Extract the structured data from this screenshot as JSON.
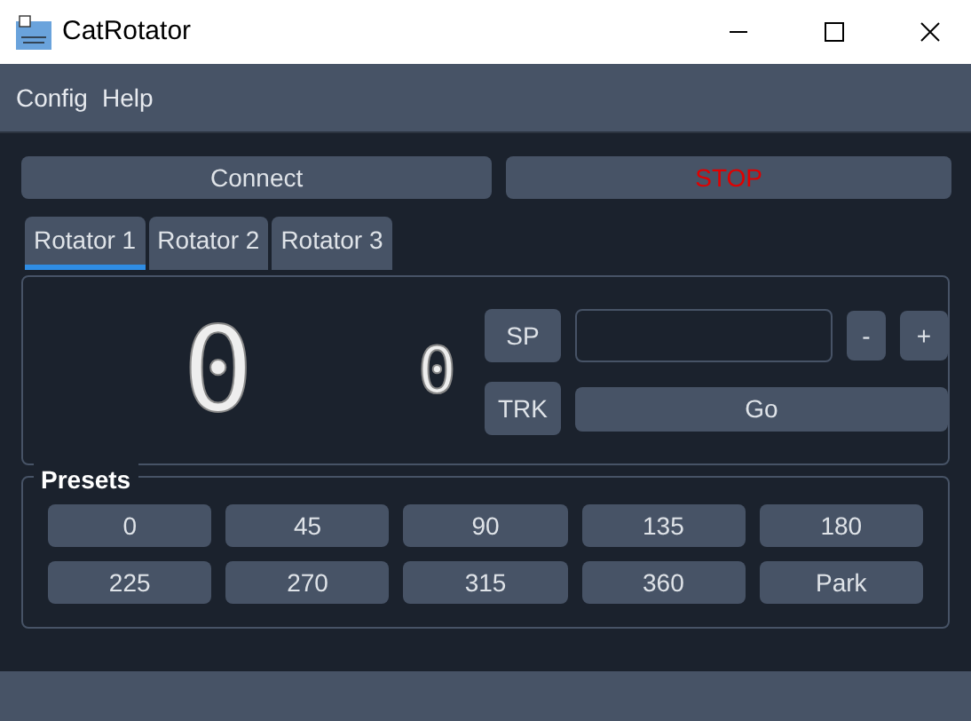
{
  "window": {
    "title": "CatRotator"
  },
  "menu": [
    "Config",
    "Help"
  ],
  "buttons": {
    "connect": "Connect",
    "stop": "STOP"
  },
  "tabs": [
    {
      "label": "Rotator 1",
      "selected": true
    },
    {
      "label": "Rotator 2",
      "selected": false
    },
    {
      "label": "Rotator 3",
      "selected": false
    }
  ],
  "rotator": {
    "azimuth_display": "0",
    "elevation_display": "0",
    "sp": "SP",
    "trk": "TRK",
    "minus": "-",
    "plus": "+",
    "go": "Go"
  },
  "presets": {
    "title": "Presets",
    "items": [
      "0",
      "45",
      "90",
      "135",
      "180",
      "225",
      "270",
      "315",
      "360",
      "Park"
    ]
  }
}
